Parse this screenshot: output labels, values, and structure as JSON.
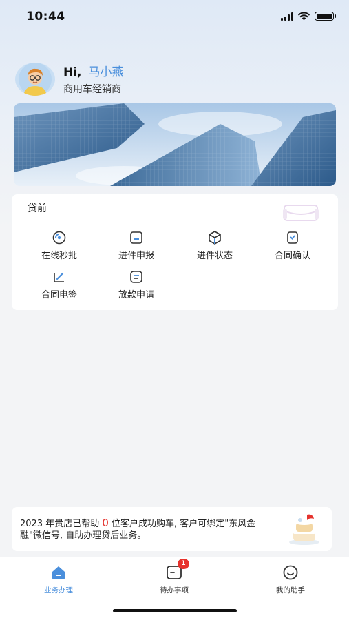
{
  "status_bar": {
    "time": "10:44"
  },
  "header": {
    "greeting": "Hi,",
    "name": "马小燕",
    "role": "商用车经销商"
  },
  "loan_card": {
    "title": "贷前",
    "items": [
      {
        "label": "在线秒批",
        "icon": "clock-check-icon"
      },
      {
        "label": "进件申报",
        "icon": "form-submit-icon"
      },
      {
        "label": "进件状态",
        "icon": "cube-status-icon"
      },
      {
        "label": "合同确认",
        "icon": "contract-confirm-icon"
      },
      {
        "label": "合同电签",
        "icon": "e-sign-icon"
      },
      {
        "label": "放款申请",
        "icon": "loan-apply-icon"
      }
    ]
  },
  "notice": {
    "prefix": "2023 年贵店已帮助 ",
    "count": "0",
    "suffix": " 位客户成功购车, 客户可绑定\"东风金融\"微信号, 自助办理贷后业务。"
  },
  "tabbar": {
    "tabs": [
      {
        "label": "业务办理",
        "icon": "home-icon",
        "active": true
      },
      {
        "label": "待办事项",
        "icon": "todo-icon",
        "badge": "1"
      },
      {
        "label": "我的助手",
        "icon": "assistant-icon"
      }
    ]
  },
  "colors": {
    "accent": "#4a8fdc",
    "badge": "#e7322c",
    "highlight": "#e5322d"
  }
}
